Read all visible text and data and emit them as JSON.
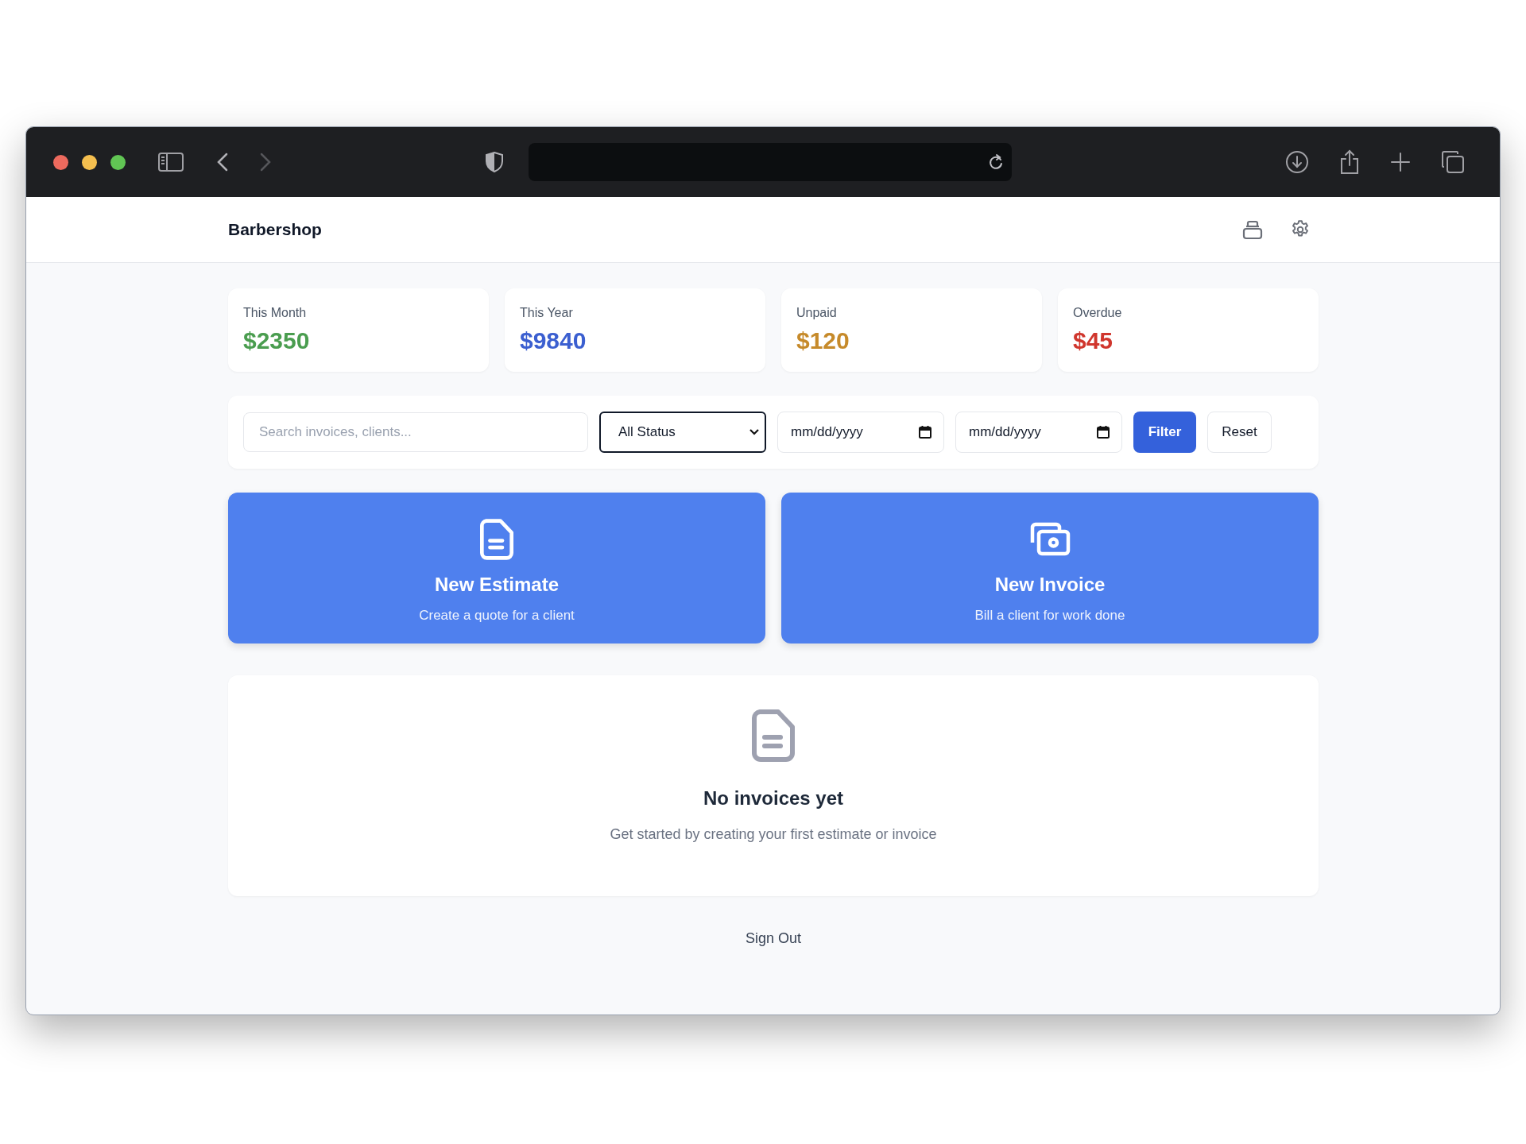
{
  "app": {
    "title": "Barbershop"
  },
  "stats": [
    {
      "label": "This Month",
      "value": "$2350",
      "color": "#4a9d4f"
    },
    {
      "label": "This Year",
      "value": "$9840",
      "color": "#3b5fd0"
    },
    {
      "label": "Unpaid",
      "value": "$120",
      "color": "#c68a2a"
    },
    {
      "label": "Overdue",
      "value": "$45",
      "color": "#d0362d"
    }
  ],
  "filters": {
    "search": {
      "placeholder": "Search invoices, clients..."
    },
    "status": {
      "value": "All Status"
    },
    "date_from": {
      "placeholder": "mm/dd/yyyy"
    },
    "date_to": {
      "placeholder": "mm/dd/yyyy"
    },
    "buttons": [
      "Filter",
      "Reset"
    ]
  },
  "actions": [
    {
      "kind": "estimate",
      "title": "New Estimate",
      "subtitle": "Create a quote for a client"
    },
    {
      "kind": "invoice",
      "title": "New Invoice",
      "subtitle": "Bill a client for work done"
    }
  ],
  "empty_state": {
    "title": "No invoices yet",
    "message": "Get started by creating your first estimate or invoice"
  },
  "footer": {
    "link": "Sign Out"
  }
}
